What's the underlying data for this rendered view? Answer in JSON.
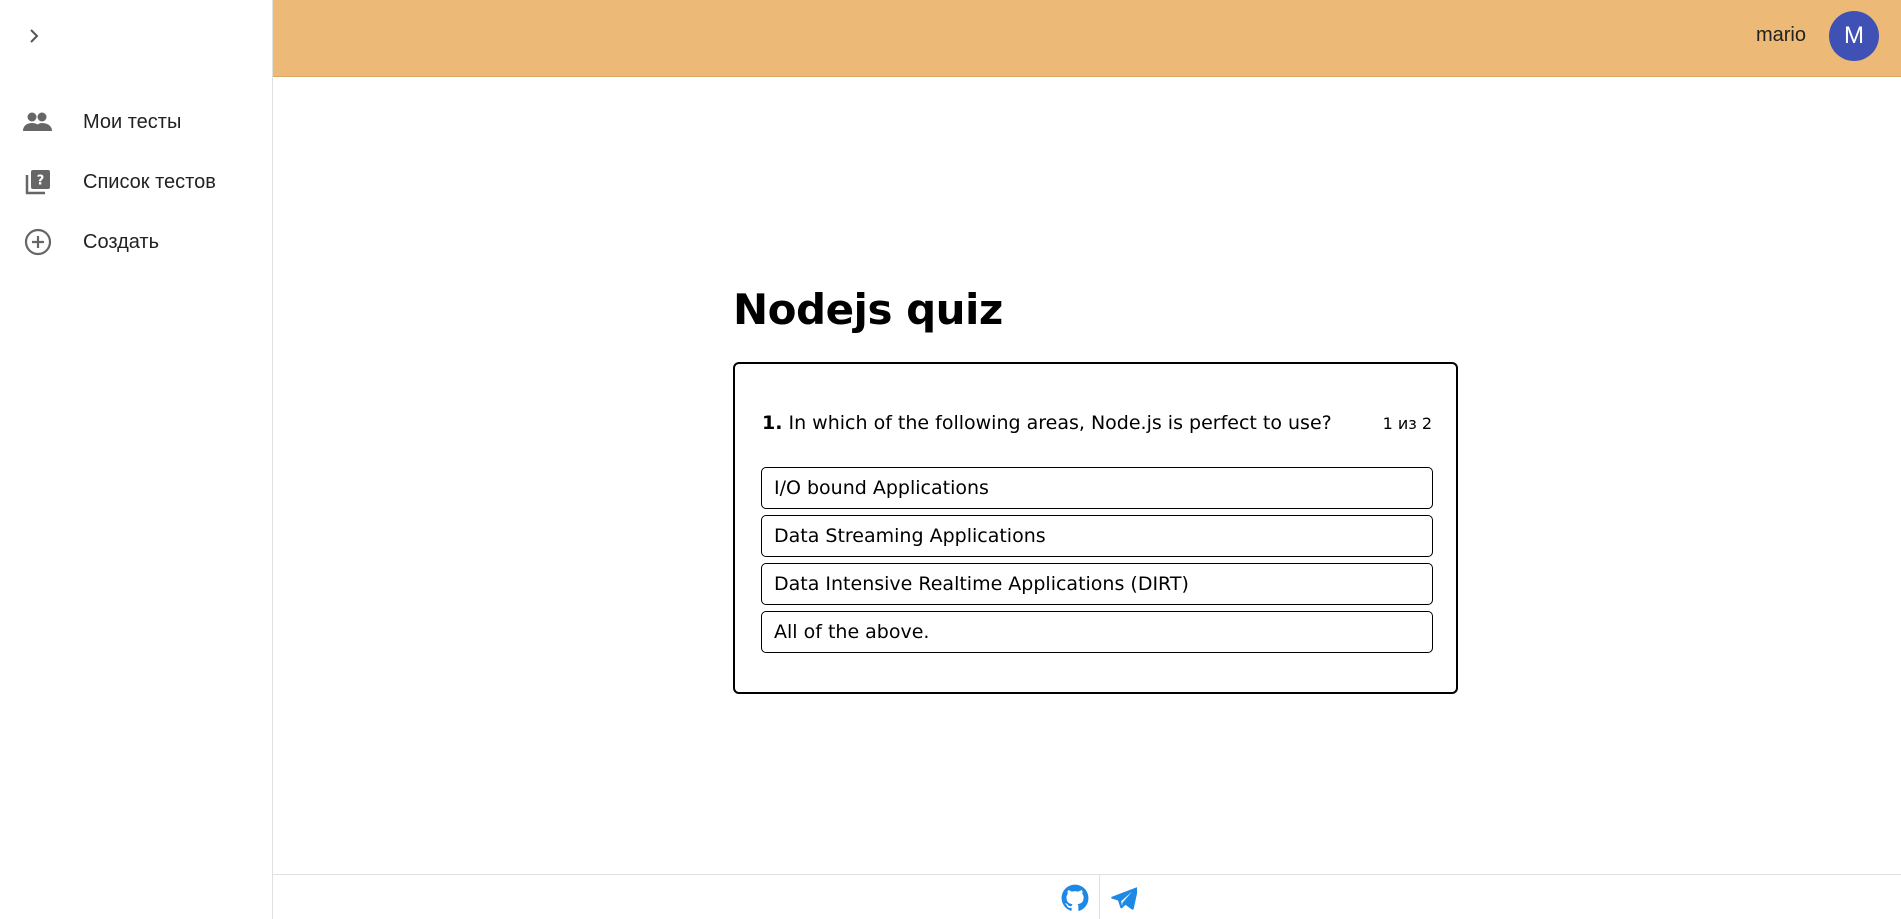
{
  "sidebar": {
    "items": [
      {
        "label": "Мои тесты",
        "icon": "people-icon"
      },
      {
        "label": "Список тестов",
        "icon": "quiz-list-icon"
      },
      {
        "label": "Создать",
        "icon": "add-circle-icon"
      }
    ]
  },
  "header": {
    "username": "mario",
    "avatar_initial": "M",
    "bg_color": "#ecba76",
    "avatar_color": "#3f51b5"
  },
  "quiz": {
    "title": "Nodejs quiz",
    "question_number": "1.",
    "question_text": "In which of the following areas, Node.js is perfect to use?",
    "counter": "1 из 2",
    "answers": [
      "I/O bound Applications",
      "Data Streaming Applications",
      "Data Intensive Realtime Applications (DIRT)",
      "All of the above."
    ]
  },
  "footer": {
    "links": [
      {
        "icon": "github-icon"
      },
      {
        "icon": "telegram-icon"
      }
    ],
    "icon_color": "#1e88e5"
  }
}
